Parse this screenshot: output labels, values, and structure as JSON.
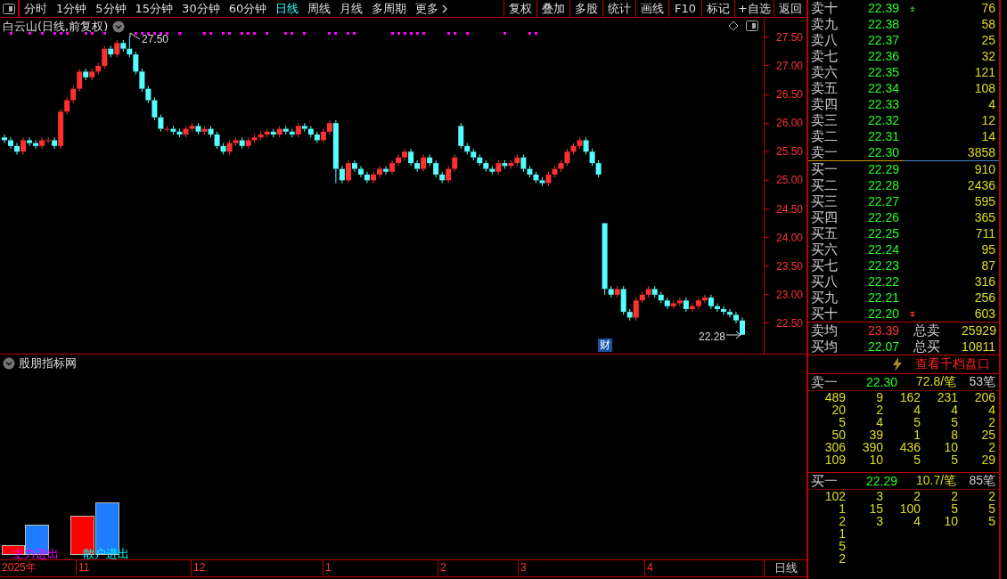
{
  "toolbar": {
    "periods": [
      {
        "label": "分时",
        "selected": false
      },
      {
        "label": "1分钟",
        "selected": false
      },
      {
        "label": "5分钟",
        "selected": false
      },
      {
        "label": "15分钟",
        "selected": false
      },
      {
        "label": "30分钟",
        "selected": false
      },
      {
        "label": "60分钟",
        "selected": false
      },
      {
        "label": "日线",
        "selected": true
      },
      {
        "label": "周线",
        "selected": false
      },
      {
        "label": "月线",
        "selected": false
      },
      {
        "label": "多周期",
        "selected": false
      }
    ],
    "more": "更多",
    "buttons": [
      "复权",
      "叠加",
      "多股",
      "统计",
      "画线",
      "F10",
      "标记",
      "+自选",
      "返回"
    ]
  },
  "chart": {
    "title": "白云山(日线,前复权)",
    "peak_label": "27.50",
    "last_label": "22.28",
    "event_badge": "财",
    "chart_data": {
      "type": "candlestick",
      "ylim": [
        21.97,
        27.84
      ],
      "categories": [
        null,
        null,
        null,
        null,
        null,
        null,
        null,
        null,
        null,
        null,
        null,
        null,
        null,
        null,
        null,
        null,
        null,
        null,
        null,
        null,
        null,
        null,
        null,
        null,
        null,
        null,
        null,
        null,
        null,
        null,
        null,
        null,
        null,
        null,
        null,
        null,
        null,
        null,
        null,
        null,
        null,
        null,
        null,
        null,
        null,
        null,
        null,
        null,
        null,
        null,
        null,
        null,
        null,
        null,
        null,
        null,
        null,
        null,
        null,
        null,
        null,
        null,
        null,
        null,
        null,
        null,
        null,
        null,
        null,
        null,
        null,
        null,
        null,
        null,
        null,
        null,
        null,
        null,
        null,
        null,
        null,
        null,
        null,
        null,
        null,
        null,
        null,
        null,
        null,
        null,
        null,
        null,
        null,
        null,
        null,
        null,
        null,
        null,
        null,
        null,
        null,
        null,
        null,
        null,
        null,
        null,
        null,
        null,
        null,
        null,
        null,
        null,
        null,
        null,
        null,
        null,
        null,
        null,
        null
      ],
      "yticks": [
        {
          "value": 27.5,
          "label": "27.50"
        },
        {
          "value": 27,
          "label": "27.00"
        },
        {
          "value": 26.5,
          "label": "26.50"
        },
        {
          "value": 26,
          "label": "26.00"
        },
        {
          "value": 25.5,
          "label": "25.50"
        },
        {
          "value": 25,
          "label": "25.00"
        },
        {
          "value": 24.5,
          "label": "24.50"
        },
        {
          "value": 24,
          "label": "24.00"
        },
        {
          "value": 23.5,
          "label": "23.50"
        },
        {
          "value": 23,
          "label": "23.00"
        },
        {
          "value": 22.5,
          "label": "22.50"
        }
      ],
      "ohlc": [
        [
          25.75,
          25.8,
          25.65,
          25.7
        ],
        [
          25.7,
          25.75,
          25.55,
          25.6
        ],
        [
          25.6,
          25.65,
          25.45,
          25.5
        ],
        [
          25.5,
          25.75,
          25.45,
          25.7
        ],
        [
          25.7,
          25.75,
          25.6,
          25.65
        ],
        [
          25.65,
          25.7,
          25.55,
          25.6
        ],
        [
          25.6,
          25.75,
          25.55,
          25.7
        ],
        [
          25.7,
          25.75,
          25.65,
          25.7
        ],
        [
          25.7,
          25.75,
          25.55,
          25.6
        ],
        [
          25.6,
          26.25,
          25.55,
          26.2
        ],
        [
          26.2,
          26.45,
          26.15,
          26.4
        ],
        [
          26.4,
          26.65,
          26.35,
          26.6
        ],
        [
          26.6,
          26.95,
          26.55,
          26.9
        ],
        [
          26.9,
          26.95,
          26.75,
          26.8
        ],
        [
          26.8,
          26.95,
          26.75,
          26.9
        ],
        [
          26.9,
          27.05,
          26.85,
          27.0
        ],
        [
          27.0,
          27.35,
          26.95,
          27.3
        ],
        [
          27.3,
          27.35,
          27.15,
          27.2
        ],
        [
          27.2,
          27.45,
          27.15,
          27.4
        ],
        [
          27.4,
          27.45,
          27.25,
          27.3
        ],
        [
          27.3,
          27.5,
          27.15,
          27.2
        ],
        [
          27.2,
          27.25,
          26.85,
          26.9
        ],
        [
          26.9,
          26.95,
          26.55,
          26.6
        ],
        [
          26.6,
          26.65,
          26.35,
          26.4
        ],
        [
          26.4,
          26.45,
          26.05,
          26.1
        ],
        [
          26.1,
          26.15,
          25.85,
          25.9
        ],
        [
          25.9,
          25.95,
          25.85,
          25.9
        ],
        [
          25.9,
          25.95,
          25.8,
          25.85
        ],
        [
          25.85,
          25.9,
          25.75,
          25.8
        ],
        [
          25.8,
          25.95,
          25.75,
          25.9
        ],
        [
          25.9,
          26.0,
          25.85,
          25.95
        ],
        [
          25.95,
          26.0,
          25.8,
          25.85
        ],
        [
          25.85,
          25.95,
          25.8,
          25.9
        ],
        [
          25.9,
          25.95,
          25.75,
          25.8
        ],
        [
          25.8,
          25.85,
          25.55,
          25.6
        ],
        [
          25.6,
          25.65,
          25.45,
          25.5
        ],
        [
          25.5,
          25.7,
          25.45,
          25.65
        ],
        [
          25.65,
          25.75,
          25.6,
          25.7
        ],
        [
          25.7,
          25.75,
          25.55,
          25.6
        ],
        [
          25.6,
          25.75,
          25.55,
          25.7
        ],
        [
          25.7,
          25.8,
          25.65,
          25.75
        ],
        [
          25.75,
          25.85,
          25.7,
          25.8
        ],
        [
          25.8,
          25.9,
          25.75,
          25.85
        ],
        [
          25.85,
          25.9,
          25.75,
          25.8
        ],
        [
          25.8,
          25.95,
          25.75,
          25.9
        ],
        [
          25.9,
          25.95,
          25.8,
          25.85
        ],
        [
          25.85,
          25.9,
          25.75,
          25.8
        ],
        [
          25.8,
          26.0,
          25.75,
          25.95
        ],
        [
          25.95,
          26.0,
          25.85,
          25.9
        ],
        [
          25.9,
          25.95,
          25.75,
          25.8
        ],
        [
          25.8,
          25.85,
          25.65,
          25.7
        ],
        [
          25.7,
          25.9,
          25.65,
          25.85
        ],
        [
          25.85,
          26.05,
          25.8,
          26.0
        ],
        [
          26.0,
          26.05,
          24.95,
          25.2
        ],
        [
          25.2,
          25.25,
          24.95,
          25.0
        ],
        [
          25.0,
          25.35,
          24.95,
          25.3
        ],
        [
          25.3,
          25.35,
          25.15,
          25.2
        ],
        [
          25.2,
          25.25,
          25.05,
          25.1
        ],
        [
          25.1,
          25.15,
          24.95,
          25.0
        ],
        [
          25.0,
          25.15,
          24.95,
          25.1
        ],
        [
          25.1,
          25.25,
          25.05,
          25.2
        ],
        [
          25.2,
          25.25,
          25.1,
          25.15
        ],
        [
          25.15,
          25.35,
          25.1,
          25.3
        ],
        [
          25.3,
          25.45,
          25.25,
          25.4
        ],
        [
          25.4,
          25.55,
          25.35,
          25.5
        ],
        [
          25.5,
          25.55,
          25.25,
          25.3
        ],
        [
          25.3,
          25.35,
          25.15,
          25.2
        ],
        [
          25.2,
          25.45,
          25.15,
          25.4
        ],
        [
          25.4,
          25.45,
          25.25,
          25.3
        ],
        [
          25.3,
          25.35,
          25.05,
          25.1
        ],
        [
          25.1,
          25.15,
          24.95,
          25.0
        ],
        [
          25.0,
          25.25,
          24.95,
          25.2
        ],
        [
          25.2,
          25.45,
          25.15,
          25.4
        ],
        [
          25.95,
          26.0,
          25.55,
          25.6
        ],
        [
          25.6,
          25.65,
          25.45,
          25.5
        ],
        [
          25.5,
          25.55,
          25.35,
          25.4
        ],
        [
          25.4,
          25.45,
          25.25,
          25.3
        ],
        [
          25.3,
          25.35,
          25.15,
          25.2
        ],
        [
          25.2,
          25.25,
          25.1,
          25.15
        ],
        [
          25.15,
          25.35,
          25.1,
          25.3
        ],
        [
          25.3,
          25.35,
          25.2,
          25.25
        ],
        [
          25.25,
          25.35,
          25.2,
          25.3
        ],
        [
          25.3,
          25.45,
          25.25,
          25.4
        ],
        [
          25.4,
          25.45,
          25.15,
          25.2
        ],
        [
          25.2,
          25.25,
          25.05,
          25.1
        ],
        [
          25.1,
          25.15,
          24.95,
          25.0
        ],
        [
          25.0,
          25.05,
          24.9,
          24.95
        ],
        [
          24.95,
          25.15,
          24.9,
          25.1
        ],
        [
          25.1,
          25.25,
          25.05,
          25.2
        ],
        [
          25.2,
          25.35,
          25.15,
          25.3
        ],
        [
          25.3,
          25.55,
          25.25,
          25.5
        ],
        [
          25.5,
          25.65,
          25.45,
          25.6
        ],
        [
          25.6,
          25.75,
          25.55,
          25.7
        ],
        [
          25.7,
          25.75,
          25.45,
          25.5
        ],
        [
          25.5,
          25.55,
          25.25,
          25.3
        ],
        [
          25.3,
          25.35,
          25.05,
          25.1
        ],
        [
          24.25,
          24.25,
          23.0,
          23.1
        ],
        [
          23.1,
          23.15,
          22.95,
          23.0
        ],
        [
          23.0,
          23.15,
          22.95,
          23.1
        ],
        [
          23.1,
          23.15,
          22.65,
          22.7
        ],
        [
          22.7,
          22.75,
          22.55,
          22.6
        ],
        [
          22.6,
          22.95,
          22.55,
          22.9
        ],
        [
          22.9,
          23.05,
          22.85,
          23.0
        ],
        [
          23.0,
          23.15,
          22.95,
          23.1
        ],
        [
          23.1,
          23.15,
          22.95,
          23.0
        ],
        [
          23.0,
          23.05,
          22.85,
          22.9
        ],
        [
          22.9,
          22.95,
          22.75,
          22.8
        ],
        [
          22.8,
          22.9,
          22.75,
          22.85
        ],
        [
          22.85,
          22.95,
          22.8,
          22.9
        ],
        [
          22.9,
          22.95,
          22.7,
          22.75
        ],
        [
          22.75,
          22.85,
          22.7,
          22.8
        ],
        [
          22.8,
          22.95,
          22.75,
          22.9
        ],
        [
          22.9,
          23.0,
          22.85,
          22.95
        ],
        [
          22.95,
          23.0,
          22.75,
          22.8
        ],
        [
          22.8,
          22.85,
          22.7,
          22.75
        ],
        [
          22.75,
          22.8,
          22.65,
          22.7
        ],
        [
          22.7,
          22.75,
          22.6,
          22.65
        ],
        [
          22.65,
          22.7,
          22.5,
          22.55
        ],
        [
          22.55,
          22.6,
          22.28,
          22.3
        ]
      ]
    }
  },
  "indicator": {
    "title": "股朋指标网",
    "legend": [
      {
        "label": "主力进出",
        "color": "#ff00ff"
      },
      {
        "label": "散户进出",
        "color": "#00ffff"
      }
    ]
  },
  "date_axis": {
    "labels": [
      "2025年",
      "11",
      "12",
      "1",
      "2",
      "3",
      "4"
    ],
    "period": "日线"
  },
  "order_book": {
    "asks_more": true,
    "asks": [
      {
        "label": "卖十",
        "price": "22.39",
        "volume": "76"
      },
      {
        "label": "卖九",
        "price": "22.38",
        "volume": "58"
      },
      {
        "label": "卖八",
        "price": "22.37",
        "volume": "25"
      },
      {
        "label": "卖七",
        "price": "22.36",
        "volume": "32"
      },
      {
        "label": "卖六",
        "price": "22.35",
        "volume": "121"
      },
      {
        "label": "卖五",
        "price": "22.34",
        "volume": "108"
      },
      {
        "label": "卖四",
        "price": "22.33",
        "volume": "4"
      },
      {
        "label": "卖三",
        "price": "22.32",
        "volume": "12"
      },
      {
        "label": "卖二",
        "price": "22.31",
        "volume": "14"
      },
      {
        "label": "卖一",
        "price": "22.30",
        "volume": "3858"
      }
    ],
    "bids_more": true,
    "bids": [
      {
        "label": "买一",
        "price": "22.29",
        "volume": "910"
      },
      {
        "label": "买二",
        "price": "22.28",
        "volume": "2436"
      },
      {
        "label": "买三",
        "price": "22.27",
        "volume": "595"
      },
      {
        "label": "买四",
        "price": "22.26",
        "volume": "365"
      },
      {
        "label": "买五",
        "price": "22.25",
        "volume": "711"
      },
      {
        "label": "买六",
        "price": "22.24",
        "volume": "95"
      },
      {
        "label": "买七",
        "price": "22.23",
        "volume": "87"
      },
      {
        "label": "买八",
        "price": "22.22",
        "volume": "316"
      },
      {
        "label": "买九",
        "price": "22.21",
        "volume": "256"
      },
      {
        "label": "买十",
        "price": "22.20",
        "volume": "603"
      }
    ],
    "averages": [
      {
        "label": "卖均",
        "price": "23.39",
        "color": "#ff3333",
        "total_label": "总卖",
        "total": "25929"
      },
      {
        "label": "买均",
        "price": "22.07",
        "color": "#22ff22",
        "total_label": "总买",
        "total": "10811"
      }
    ],
    "depth_link": "查看千档盘口"
  },
  "tick_detail": [
    {
      "label": "卖一",
      "price": "22.30",
      "average": "72.8/笔",
      "count": "53笔",
      "rows": [
        [
          "489",
          "9",
          "162",
          "231",
          "206"
        ],
        [
          "20",
          "2",
          "4",
          "4",
          "4"
        ],
        [
          "5",
          "4",
          "5",
          "5",
          "2"
        ],
        [
          "50",
          "39",
          "1",
          "8",
          "25"
        ],
        [
          "306",
          "390",
          "436",
          "10",
          "2"
        ],
        [
          "109",
          "10",
          "5",
          "5",
          "29"
        ]
      ]
    },
    {
      "label": "买一",
      "price": "22.29",
      "average": "10.7/笔",
      "count": "85笔",
      "rows": [
        [
          "102",
          "3",
          "2",
          "2",
          "2"
        ],
        [
          "1",
          "15",
          "100",
          "5",
          "5"
        ],
        [
          "2",
          "3",
          "4",
          "10",
          "5"
        ],
        [
          "1"
        ],
        [
          "5"
        ],
        [
          "2"
        ]
      ]
    }
  ]
}
